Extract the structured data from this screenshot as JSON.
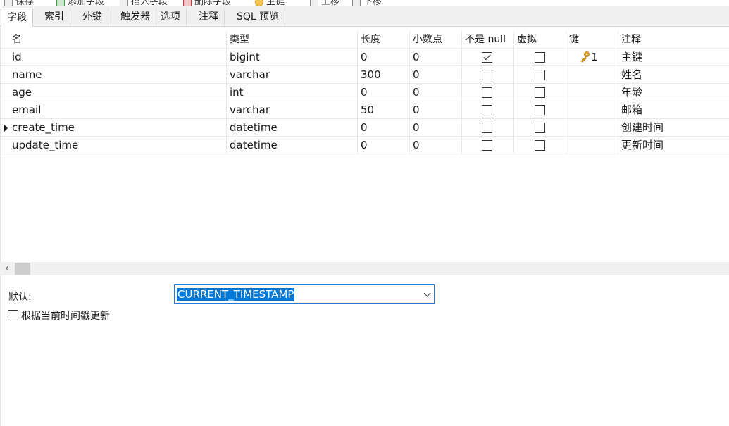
{
  "toolbar": {
    "items": [
      "保存",
      "添加字段",
      "插入字段",
      "删除字段",
      "主键",
      "上移",
      "下移"
    ]
  },
  "tabs": [
    "字段",
    "索引",
    "外键",
    "触发器",
    "选项",
    "注释",
    "SQL 预览"
  ],
  "columns": {
    "name": "名",
    "type": "类型",
    "length": "长度",
    "decimals": "小数点",
    "not_null": "不是 null",
    "virtual": "虚拟",
    "key": "键",
    "comment": "注释"
  },
  "rows": [
    {
      "name": "id",
      "type": "bigint",
      "length": "0",
      "decimals": "0",
      "not_null": true,
      "virtual": false,
      "key": "1",
      "comment": "主键",
      "selected": false
    },
    {
      "name": "name",
      "type": "varchar",
      "length": "300",
      "decimals": "0",
      "not_null": false,
      "virtual": false,
      "key": "",
      "comment": "姓名",
      "selected": false
    },
    {
      "name": "age",
      "type": "int",
      "length": "0",
      "decimals": "0",
      "not_null": false,
      "virtual": false,
      "key": "",
      "comment": "年龄",
      "selected": false
    },
    {
      "name": "email",
      "type": "varchar",
      "length": "50",
      "decimals": "0",
      "not_null": false,
      "virtual": false,
      "key": "",
      "comment": "邮箱",
      "selected": false
    },
    {
      "name": "create_time",
      "type": "datetime",
      "length": "0",
      "decimals": "0",
      "not_null": false,
      "virtual": false,
      "key": "",
      "comment": "创建时间",
      "selected": true
    },
    {
      "name": "update_time",
      "type": "datetime",
      "length": "0",
      "decimals": "0",
      "not_null": false,
      "virtual": false,
      "key": "",
      "comment": "更新时间",
      "selected": false
    }
  ],
  "properties": {
    "default_label": "默认:",
    "default_value": "CURRENT_TIMESTAMP",
    "on_update_label": "根据当前时间戳更新",
    "on_update_checked": false
  },
  "icons": {
    "key": "primary-key-icon",
    "row_marker": "current-row-arrow-icon",
    "scroll_left": "chevron-left-icon",
    "dropdown": "chevron-down-icon"
  },
  "colors": {
    "selection": "#0078d7",
    "key": "#e7a62a"
  }
}
